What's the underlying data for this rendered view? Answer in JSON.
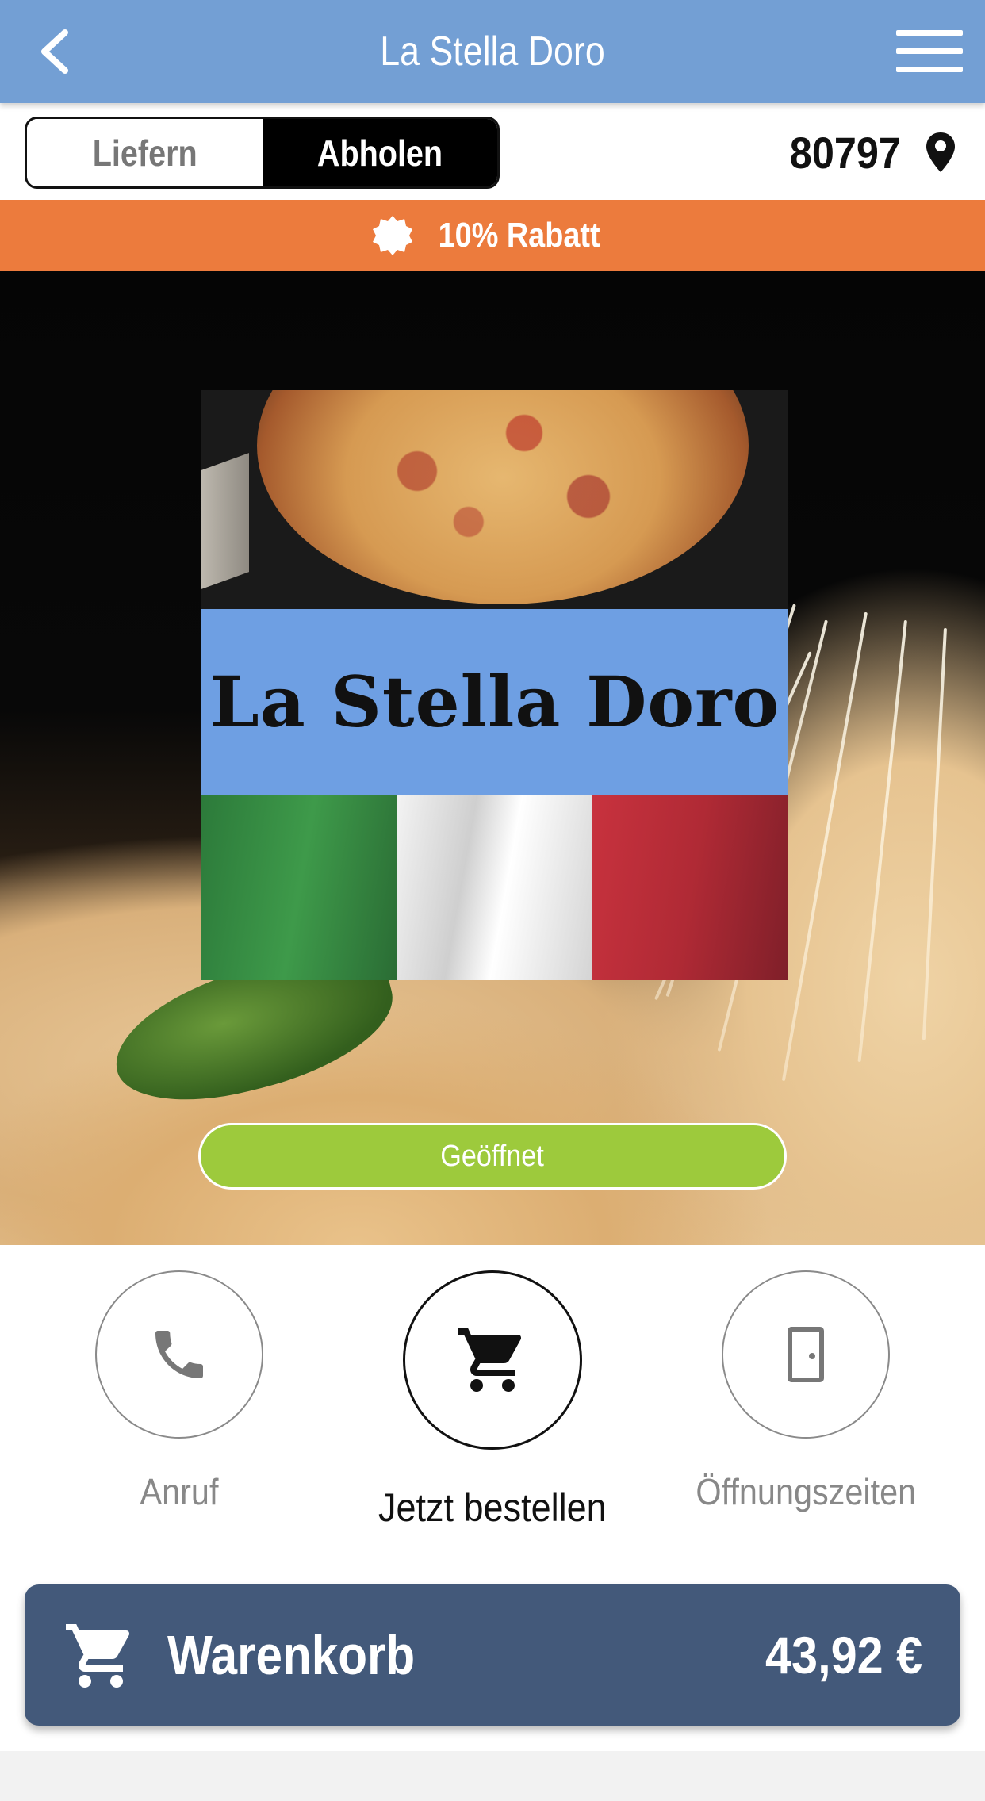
{
  "header": {
    "title": "La Stella Doro",
    "back_icon": "chevron-left-icon",
    "menu_icon": "hamburger-menu-icon",
    "background": "#739fd4"
  },
  "mode_toggle": {
    "options": [
      "Liefern",
      "Abholen"
    ],
    "selected": "Abholen"
  },
  "location": {
    "zip": "80797",
    "icon": "map-pin-icon"
  },
  "discount": {
    "text": "10% Rabatt",
    "icon": "badge-icon",
    "color": "#ec7b3d"
  },
  "hero": {
    "logo_text": "La Stella Doro",
    "status": "Geöffnet",
    "status_color": "#9dca3c"
  },
  "actions": [
    {
      "label": "Anruf",
      "icon": "phone-icon"
    },
    {
      "label": "Jetzt bestellen",
      "icon": "cart-icon"
    },
    {
      "label": "Öffnungszeiten",
      "icon": "door-icon"
    }
  ],
  "cart": {
    "label": "Warenkorb",
    "total": "43,92 €",
    "icon": "cart-icon",
    "color": "#43597a"
  }
}
